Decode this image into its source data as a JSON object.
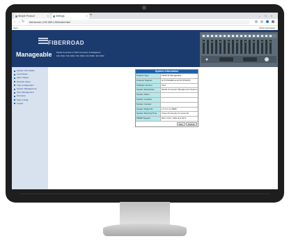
{
  "browser": {
    "tabs": [
      {
        "label": "Simple Product",
        "active": false
      },
      {
        "label": "Settings",
        "active": true
      }
    ],
    "new_tab": "+",
    "window_controls": [
      "–",
      "□",
      "×"
    ],
    "nav": {
      "back": "←",
      "forward": "→",
      "reload": "↻",
      "home": "⌂"
    },
    "address": "Not secure | 192.168.1.254/index.html",
    "bookmarks": {
      "apps": "Apps",
      "other": "Other bookmarks"
    }
  },
  "banner": {
    "logo_text": "FIBERROAD",
    "brand": "Manageable",
    "subtitle_1": "Media Converter & SFP Converter & Multiplexer",
    "subtitle_2": "FR-7100 / FR-7200 / FR-7300 / FR-7600 / FR-7900"
  },
  "sidebar": {
    "items": [
      "System Information",
      "Card Status",
      "Alarm Status",
      "Network Setup",
      "Trap Configuration",
      "System Management",
      "User Management",
      "Firmware",
      "Save Config",
      "Logout"
    ]
  },
  "info": {
    "title": "System Information",
    "rows": [
      {
        "key": "Product Type",
        "value": "FR4P-M Manageable"
      },
      {
        "key": "Protocol Support",
        "value": "HTTP/SNMPv1/v2/TFTP/SNTP"
      },
      {
        "key": "Software Version",
        "value": "V3.0"
      },
      {
        "key": "System Description",
        "value": "Media Converter Management System"
      },
      {
        "key": "System Name",
        "value": ""
      },
      {
        "key": "System Location",
        "value": ""
      },
      {
        "key": "System Contact",
        "value": ""
      },
      {
        "key": "System Object ID",
        "value": "1.3.6.1.4.1.8886"
      },
      {
        "key": "System Running Time",
        "value": "0 day 20 minutes 41 seconds"
      },
      {
        "key": "SNMP Support",
        "value": "RFC 1213, 1493 and 2674"
      }
    ],
    "buttons": {
      "save": "Save",
      "refresh": "Refresh"
    }
  },
  "colors": {
    "banner": "#1b3a6e",
    "sidebar": "#d7e2ee",
    "table_header": "#1f5ea8",
    "table_key": "#b6e8ec"
  }
}
